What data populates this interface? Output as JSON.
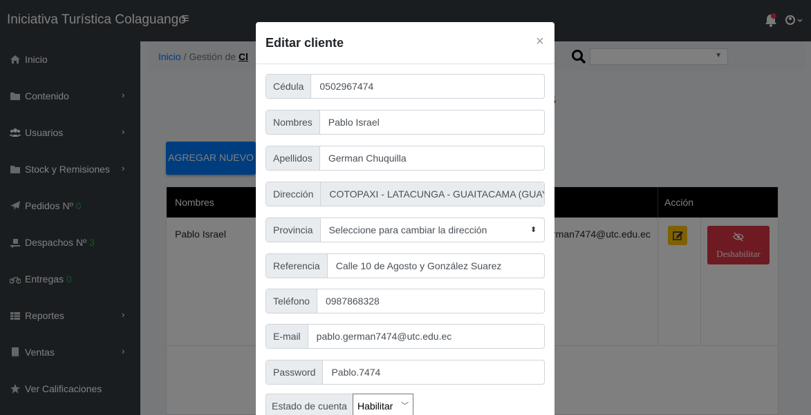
{
  "header": {
    "brand": "Iniciativa Turística Colaguango",
    "menu_glyph": "≡"
  },
  "sidebar": {
    "items": [
      {
        "label": "Inicio",
        "icon": "home-icon",
        "chevron": false
      },
      {
        "label": "Contenido",
        "icon": "folder-icon",
        "chevron": true
      },
      {
        "label": "Usuarios",
        "icon": "users-icon",
        "chevron": true
      },
      {
        "label": "Stock y Remisiones",
        "icon": "folder-icon",
        "chevron": true
      },
      {
        "label": "Pedidos Nº",
        "count": "0",
        "icon": "paper-plane-icon",
        "chevron": false
      },
      {
        "label": "Despachos Nº",
        "count": "3",
        "icon": "dolly-icon",
        "chevron": false
      },
      {
        "label": "Entregas",
        "count": "0",
        "icon": "motorcycle-icon",
        "chevron": false
      },
      {
        "label": "Reportes",
        "icon": "table-icon",
        "chevron": true
      },
      {
        "label": "Ventas",
        "icon": "receipt-icon",
        "chevron": true
      },
      {
        "label": "Ver Calificaciones",
        "icon": "star-icon",
        "chevron": false
      }
    ],
    "chevron_glyph": "›"
  },
  "breadcrumb": {
    "home": "Inicio",
    "separator": "/",
    "current": "Gestión de",
    "current_bold": "Cl"
  },
  "page": {
    "title_fragment": "s"
  },
  "add_button": "AGREGAR NUEVO",
  "table": {
    "headers": {
      "name": "Nombres",
      "action": "Acción"
    },
    "row": {
      "name": "Pablo Israel",
      "email_fragment": "rman7474@utc.edu.ec"
    },
    "disable_label": "Deshabilitar"
  },
  "modal": {
    "title": "Editar cliente",
    "close": "×",
    "fields": {
      "cedula": {
        "label": "Cédula",
        "value": "0502967474"
      },
      "nombres": {
        "label": "Nombres",
        "value": "Pablo Israel"
      },
      "apellidos": {
        "label": "Apellidos",
        "value": "German Chuquilla"
      },
      "direccion": {
        "label": "Dirección",
        "value": "COTOPAXI - LATACUNGA - GUAITACAMA (GUAYTA"
      },
      "provincia": {
        "label": "Provincia",
        "value": "Seleccione para cambiar la dirección"
      },
      "referencia": {
        "label": "Referencia",
        "value": "Calle 10 de Agosto y González Suarez"
      },
      "telefono": {
        "label": "Teléfono",
        "value": "0987868328"
      },
      "email": {
        "label": "E-mail",
        "value": "pablo.german7474@utc.edu.ec"
      },
      "password": {
        "label": "Password",
        "value": "Pablo.7474"
      },
      "estado": {
        "label": "Estado de cuenta",
        "value": "Habilitar"
      }
    }
  },
  "colors": {
    "topbar": "#343a40",
    "primary": "#007bff",
    "danger": "#dc3545",
    "warning": "#ffc107",
    "success": "#28a745"
  }
}
